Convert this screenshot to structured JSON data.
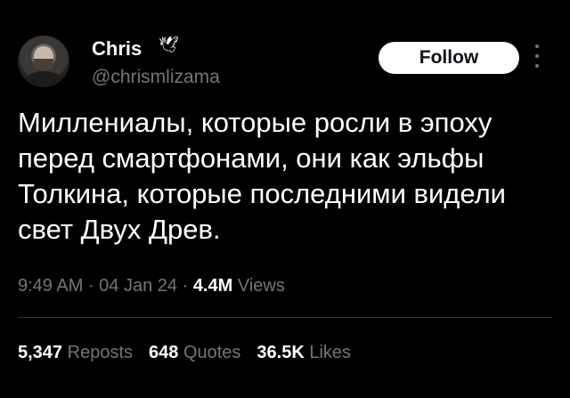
{
  "author": {
    "name": "Chris",
    "handle": "@chrismlizama",
    "badge_icon": "bird-icon"
  },
  "follow_label": "Follow",
  "tweet_text": "Миллениалы, которые росли в эпоху перед смартфонами, они как эльфы Толкина, которые последними видели свет Двух Древ.",
  "meta": {
    "time": "9:49 AM",
    "sep1": " · ",
    "date": "04 Jan 24",
    "sep2": " · ",
    "views_count": "4.4M",
    "views_label": "Views"
  },
  "stats": {
    "reposts_count": "5,347",
    "reposts_label": "Reposts",
    "quotes_count": "648",
    "quotes_label": "Quotes",
    "likes_count": "36.5K",
    "likes_label": "Likes"
  },
  "colors": {
    "background": "#000000",
    "text": "#ffffff",
    "muted": "#71767b",
    "button_bg": "#ffffff",
    "button_text": "#0f1419"
  }
}
